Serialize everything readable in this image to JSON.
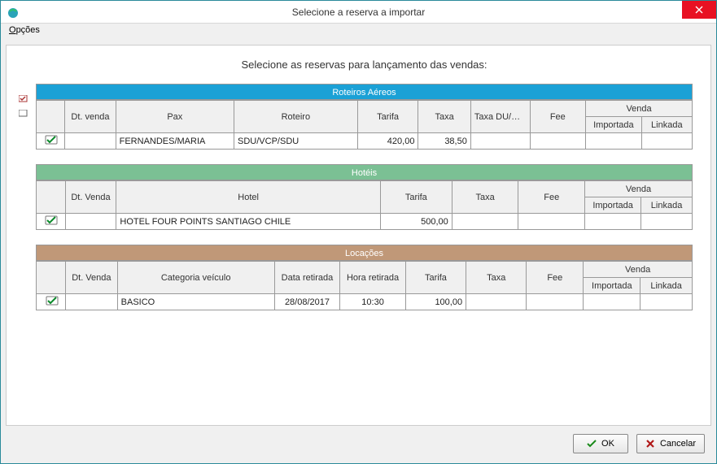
{
  "window": {
    "title": "Selecione a reserva a importar"
  },
  "menu": {
    "options": "Opções",
    "options_ul": "O"
  },
  "instruction": "Selecione as reservas para lançamento das vendas:",
  "sections": {
    "air": {
      "title": "Roteiros Aéreos",
      "headers": {
        "dt_venda": "Dt. venda",
        "pax": "Pax",
        "roteiro": "Roteiro",
        "tarifa": "Tarifa",
        "taxa": "Taxa",
        "taxa_durav": "Taxa DU/RAV",
        "fee": "Fee",
        "venda": "Venda",
        "importada": "Importada",
        "linkada": "Linkada"
      },
      "rows": [
        {
          "checked": true,
          "dt_venda": "",
          "pax": "FERNANDES/MARIA",
          "roteiro": "SDU/VCP/SDU",
          "tarifa": "420,00",
          "taxa": "38,50",
          "taxa_durav": "",
          "fee": "",
          "importada": "",
          "linkada": ""
        }
      ]
    },
    "hotel": {
      "title": "Hotéis",
      "headers": {
        "dt_venda": "Dt. Venda",
        "hotel": "Hotel",
        "tarifa": "Tarifa",
        "taxa": "Taxa",
        "fee": "Fee",
        "venda": "Venda",
        "importada": "Importada",
        "linkada": "Linkada"
      },
      "rows": [
        {
          "checked": true,
          "dt_venda": "",
          "hotel": "HOTEL FOUR POINTS SANTIAGO CHILE",
          "tarifa": "500,00",
          "taxa": "",
          "fee": "",
          "importada": "",
          "linkada": ""
        }
      ]
    },
    "loc": {
      "title": "Locações",
      "headers": {
        "dt_venda": "Dt. Venda",
        "categoria": "Categoria veículo",
        "data_ret": "Data retirada",
        "hora_ret": "Hora retirada",
        "tarifa": "Tarifa",
        "taxa": "Taxa",
        "fee": "Fee",
        "venda": "Venda",
        "importada": "Importada",
        "linkada": "Linkada"
      },
      "rows": [
        {
          "checked": true,
          "dt_venda": "",
          "categoria": "BASICO",
          "data_ret": "28/08/2017",
          "hora_ret": "10:30",
          "tarifa": "100,00",
          "taxa": "",
          "fee": "",
          "importada": "",
          "linkada": ""
        }
      ]
    }
  },
  "buttons": {
    "ok": "OK",
    "cancel": "Cancelar"
  }
}
